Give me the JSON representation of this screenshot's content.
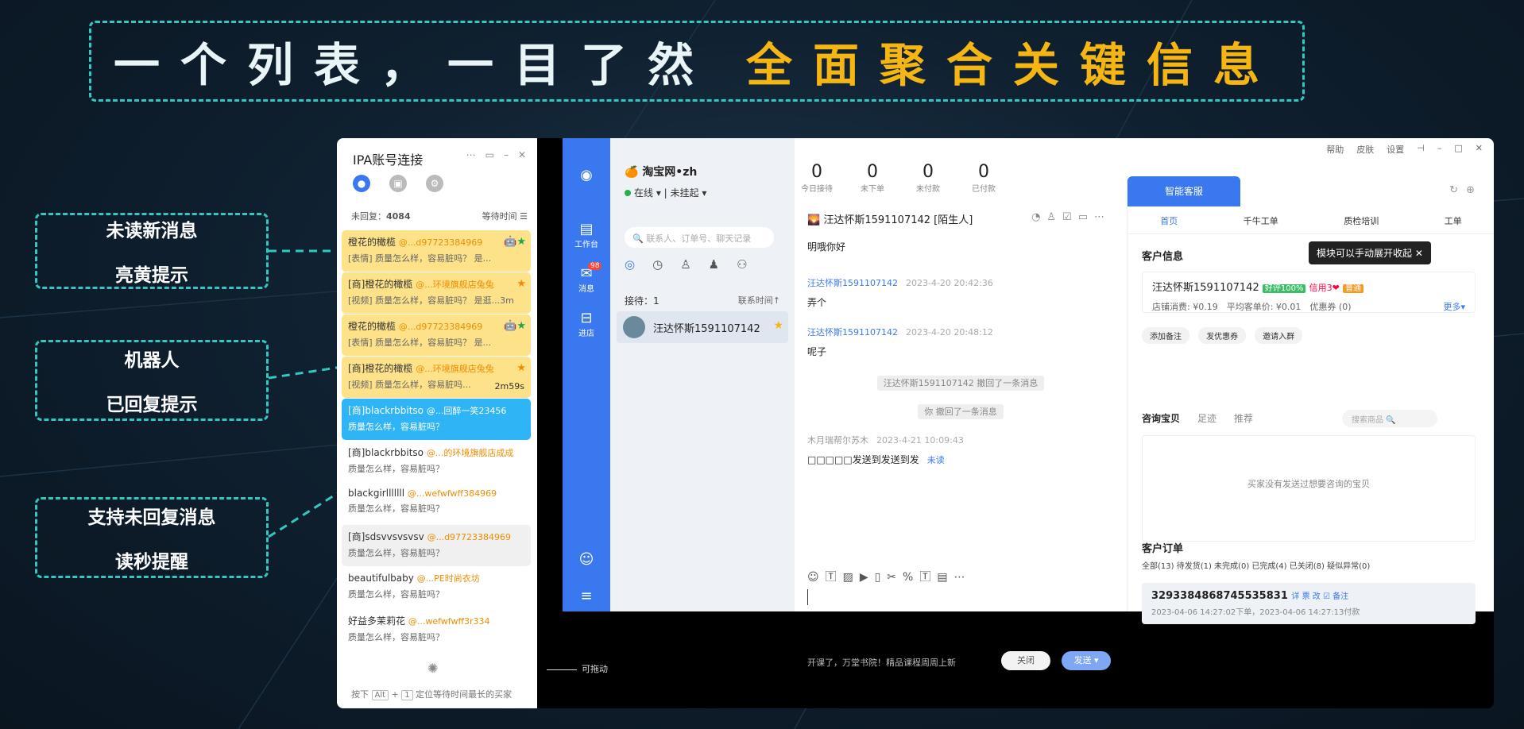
{
  "banner": {
    "white_text": "一个列表，一目了然",
    "gold_text": "全面聚合关键信息"
  },
  "callouts": [
    {
      "line1": "未读新消息",
      "line2": "亮黄提示"
    },
    {
      "line1": "机器人",
      "line2": "已回复提示"
    },
    {
      "line1": "支持未回复消息",
      "line2": "读秒提醒"
    }
  ],
  "colors": {
    "accent": "#2fc9c0",
    "gold": "#f5b512",
    "brand_blue": "#3a78f0",
    "highlight_yellow": "#fde28a"
  },
  "left_panel": {
    "title": "IPA账号连接",
    "unreplied_label": "未回复：",
    "unreplied_count": "4084",
    "sort_label": "等待时间",
    "items": [
      {
        "name": "橙花的橄榄",
        "at": "@...d97723384969",
        "msg": "[表情] 质量怎么样，容易脏吗？ 是...",
        "time": "",
        "flags": "🤖★"
      },
      {
        "name": "[商]橙花的橄榄",
        "at": "@...环境旗舰店兔兔",
        "msg": "[视频] 质量怎么样，容易脏吗？ 是逛...3m",
        "time": "",
        "flags": "★"
      },
      {
        "name": "橙花的橄榄",
        "at": "@...d97723384969",
        "msg": "[表情] 质量怎么样，容易脏吗？ 是...",
        "time": "",
        "flags": "🤖★"
      },
      {
        "name": "[商]橙花的橄榄",
        "at": "@...环境旗舰店兔兔",
        "msg": "[视频] 质量怎么样，容易脏吗...",
        "time": "2m59s",
        "flags": "★"
      },
      {
        "name": "[商]blackrbbitso",
        "at": "@...回醉一笑23456",
        "msg": "质量怎么样，容易脏吗？",
        "time": "",
        "flags": ""
      },
      {
        "name": "[商]blackrbbitso",
        "at": "@...的环境旗舰店成成",
        "msg": "质量怎么样，容易脏吗？",
        "time": "",
        "flags": ""
      },
      {
        "name": "blackgirlllllll",
        "at": "@...wefwfwff384969",
        "msg": "质量怎么样，容易脏吗？",
        "time": "",
        "flags": ""
      },
      {
        "name": "[商]sdsvvsvsvsv",
        "at": "@...d97723384969",
        "msg": "质量怎么样，容易脏吗？",
        "time": "",
        "flags": ""
      },
      {
        "name": "beautifulbaby",
        "at": "@...PE时尚衣坊",
        "msg": "质量怎么样，容易脏吗？",
        "time": "",
        "flags": ""
      },
      {
        "name": "好益多茉莉花",
        "at": "@...wefwfwff3r334",
        "msg": "质量怎么样，容易脏吗？",
        "time": "",
        "flags": ""
      }
    ],
    "footer_press": "按下",
    "key_alt": "Alt",
    "key_plus": "+",
    "key_1": "1",
    "footer_text": "定位等待时间最长的买家"
  },
  "drag_label": "可拖动",
  "nav": {
    "items": [
      {
        "label": "工作台"
      },
      {
        "label": "消息",
        "badge": "98"
      },
      {
        "label": "进店"
      }
    ]
  },
  "shop": {
    "name": "淘宝网•zh",
    "status": "在线",
    "hang": "未挂起"
  },
  "stats": [
    {
      "value": "0",
      "label": "今日接待"
    },
    {
      "value": "0",
      "label": "未下单"
    },
    {
      "value": "0",
      "label": "未付款"
    },
    {
      "value": "0",
      "label": "已付款"
    }
  ],
  "mid": {
    "search_placeholder": "联系人、订单号、聊天记录",
    "recv_label": "接待：1",
    "recv_sort": "联系时间↑",
    "contact": "汪达怀斯1591107142"
  },
  "chat": {
    "header": "汪达怀斯1591107142 [陌生人]",
    "messages": [
      {
        "who": "",
        "ts": "",
        "text": "明哦你好"
      },
      {
        "who": "汪达怀斯1591107142",
        "ts": "2023-4-20 20:42:36",
        "text": "弄个"
      },
      {
        "who": "汪达怀斯1591107142",
        "ts": "2023-4-20 20:48:12",
        "text": "呢子"
      },
      {
        "who": "木月瑞帮尔苏木",
        "ts": "2023-4-21 10:09:43",
        "text": "□□□□□发送到发送到发"
      }
    ],
    "sys1": "汪达怀斯1591107142 撤回了一条消息",
    "sys2": "你 撤回了一条消息",
    "unread": "未读",
    "hint": "开课了，万堂书院！精品课程周周上新",
    "close": "关闭",
    "send": "发送 ▾"
  },
  "right": {
    "topbar": [
      "帮助",
      "皮肤",
      "设置"
    ],
    "tab": "智能客服",
    "subtabs": [
      "首页",
      "千牛工单",
      "质检培训",
      "工单"
    ],
    "cust_title": "客户信息",
    "tooltip": "模块可以手动展开收起",
    "cust_name": "汪达怀斯1591107142",
    "good_rate": "好评100%",
    "credit": "信用3❤",
    "tag": "普通",
    "spend": "店铺消费: ¥0.19",
    "avg": "平均客单价: ¥0.01",
    "coupon": "优惠券 (0)",
    "more": "更多▾",
    "actions": [
      "添加备注",
      "发优惠券",
      "邀请入群"
    ],
    "goods_tabs": [
      "咨询宝贝",
      "足迹",
      "推荐"
    ],
    "goods_search": "搜索商品",
    "goods_empty": "买家没有发送过想要咨询的宝贝",
    "order_title": "客户订单",
    "order_tabs": "全部(13) 待发货(1) 未完成(0) 已完成(4) 已关闭(8) 疑似异常(0)",
    "order_no": "3293384868745535831",
    "order_meta": "2023-04-06 14:27:02下单，2023-04-06 14:27:13付款",
    "order_tags": "详 票 改 ☑ 备注"
  }
}
